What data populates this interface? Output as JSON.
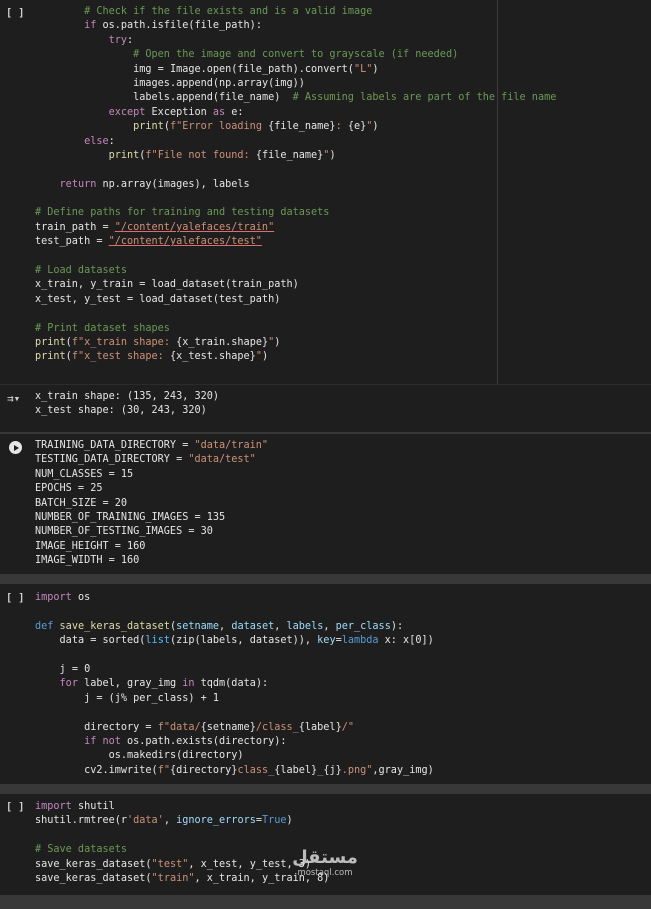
{
  "cell1": {
    "gutter": "[ ]",
    "lines": [
      {
        "indent": "        ",
        "parts": [
          [
            "cm",
            "# Check if the file exists and is a valid image"
          ]
        ]
      },
      {
        "indent": "        ",
        "parts": [
          [
            "kw2",
            "if "
          ],
          [
            "t",
            "os.path.isfile(file_path):"
          ]
        ]
      },
      {
        "indent": "            ",
        "parts": [
          [
            "kw2",
            "try"
          ],
          [
            "t",
            ":"
          ]
        ]
      },
      {
        "indent": "                ",
        "parts": [
          [
            "cm",
            "# Open the image and convert to grayscale (if needed)"
          ]
        ]
      },
      {
        "indent": "                ",
        "parts": [
          [
            "t",
            "img = Image.open(file_path).convert("
          ],
          [
            "str",
            "\"L\""
          ],
          [
            "t",
            ")"
          ]
        ]
      },
      {
        "indent": "                ",
        "parts": [
          [
            "t",
            "images.append(np.array(img))"
          ]
        ]
      },
      {
        "indent": "                ",
        "parts": [
          [
            "t",
            "labels.append(file_name)  "
          ],
          [
            "cm",
            "# Assuming labels are part of the file name"
          ]
        ]
      },
      {
        "indent": "            ",
        "parts": [
          [
            "kw2",
            "except "
          ],
          [
            "t",
            "Exception "
          ],
          [
            "kw2",
            "as "
          ],
          [
            "t",
            "e:"
          ]
        ]
      },
      {
        "indent": "                ",
        "parts": [
          [
            "fn",
            "print"
          ],
          [
            "t",
            "("
          ],
          [
            "str",
            "f\"Error loading "
          ],
          [
            "t",
            "{file_name}"
          ],
          [
            "str",
            ": "
          ],
          [
            "t",
            "{e}"
          ],
          [
            "str",
            "\""
          ],
          [
            "t",
            ")"
          ]
        ]
      },
      {
        "indent": "        ",
        "parts": [
          [
            "kw2",
            "else"
          ],
          [
            "t",
            ":"
          ]
        ]
      },
      {
        "indent": "            ",
        "parts": [
          [
            "fn",
            "print"
          ],
          [
            "t",
            "("
          ],
          [
            "str",
            "f\"File not found: "
          ],
          [
            "t",
            "{file_name}"
          ],
          [
            "str",
            "\""
          ],
          [
            "t",
            ")"
          ]
        ]
      },
      {
        "indent": "",
        "parts": []
      },
      {
        "indent": "    ",
        "parts": [
          [
            "kw2",
            "return "
          ],
          [
            "t",
            "np.array(images), labels"
          ]
        ]
      },
      {
        "indent": "",
        "parts": []
      },
      {
        "indent": "",
        "parts": [
          [
            "cm",
            "# Define paths for training and testing datasets"
          ]
        ]
      },
      {
        "indent": "",
        "parts": [
          [
            "t",
            "train_path = "
          ],
          [
            "stru",
            "\"/content/yalefaces/train\""
          ]
        ]
      },
      {
        "indent": "",
        "parts": [
          [
            "t",
            "test_path = "
          ],
          [
            "stru",
            "\"/content/yalefaces/test\""
          ]
        ]
      },
      {
        "indent": "",
        "parts": []
      },
      {
        "indent": "",
        "parts": [
          [
            "cm",
            "# Load datasets"
          ]
        ]
      },
      {
        "indent": "",
        "parts": [
          [
            "t",
            "x_train, y_train = load_dataset(train_path)"
          ]
        ]
      },
      {
        "indent": "",
        "parts": [
          [
            "t",
            "x_test, y_test = load_dataset(test_path)"
          ]
        ]
      },
      {
        "indent": "",
        "parts": []
      },
      {
        "indent": "",
        "parts": [
          [
            "cm",
            "# Print dataset shapes"
          ]
        ]
      },
      {
        "indent": "",
        "parts": [
          [
            "fn",
            "print"
          ],
          [
            "t",
            "("
          ],
          [
            "str",
            "f\"x_train shape: "
          ],
          [
            "t",
            "{x_train.shape}"
          ],
          [
            "str",
            "\""
          ],
          [
            "t",
            ")"
          ]
        ]
      },
      {
        "indent": "",
        "parts": [
          [
            "fn",
            "print"
          ],
          [
            "t",
            "("
          ],
          [
            "str",
            "f\"x_test shape: "
          ],
          [
            "t",
            "{x_test.shape}"
          ],
          [
            "str",
            "\""
          ],
          [
            "t",
            ")"
          ]
        ]
      }
    ]
  },
  "output1": {
    "lines": [
      "x_train shape: (135, 243, 320)",
      "x_test shape: (30, 243, 320)"
    ]
  },
  "cell2": {
    "lines": [
      {
        "indent": "",
        "parts": [
          [
            "t",
            "TRAINING_DATA_DIRECTORY = "
          ],
          [
            "str",
            "\"data/train\""
          ]
        ]
      },
      {
        "indent": "",
        "parts": [
          [
            "t",
            "TESTING_DATA_DIRECTORY = "
          ],
          [
            "str",
            "\"data/test\""
          ]
        ]
      },
      {
        "indent": "",
        "parts": [
          [
            "t",
            "NUM_CLASSES = 15"
          ]
        ]
      },
      {
        "indent": "",
        "parts": [
          [
            "t",
            "EPOCHS = 25"
          ]
        ]
      },
      {
        "indent": "",
        "parts": [
          [
            "t",
            "BATCH_SIZE = 20"
          ]
        ]
      },
      {
        "indent": "",
        "parts": [
          [
            "t",
            "NUMBER_OF_TRAINING_IMAGES = 135"
          ]
        ]
      },
      {
        "indent": "",
        "parts": [
          [
            "t",
            "NUMBER_OF_TESTING_IMAGES = 30"
          ]
        ]
      },
      {
        "indent": "",
        "parts": [
          [
            "t",
            "IMAGE_HEIGHT = 160"
          ]
        ]
      },
      {
        "indent": "",
        "parts": [
          [
            "t",
            "IMAGE_WIDTH = 160"
          ]
        ]
      }
    ]
  },
  "cell3": {
    "gutter": "[ ]",
    "lines": [
      {
        "indent": "",
        "parts": [
          [
            "kw2",
            "import "
          ],
          [
            "t",
            "os"
          ]
        ]
      },
      {
        "indent": "",
        "parts": []
      },
      {
        "indent": "",
        "parts": [
          [
            "kw",
            "def "
          ],
          [
            "fn",
            "save_keras_dataset"
          ],
          [
            "t",
            "("
          ],
          [
            "var",
            "setname"
          ],
          [
            "t",
            ", "
          ],
          [
            "var",
            "dataset"
          ],
          [
            "t",
            ", "
          ],
          [
            "var",
            "labels"
          ],
          [
            "t",
            ", "
          ],
          [
            "var",
            "per_class"
          ],
          [
            "t",
            "):"
          ]
        ]
      },
      {
        "indent": "    ",
        "parts": [
          [
            "t",
            "data = sorted("
          ],
          [
            "bl",
            "list"
          ],
          [
            "t",
            "(zip(labels, dataset)), "
          ],
          [
            "var",
            "key"
          ],
          [
            "t",
            "="
          ],
          [
            "kw",
            "lambda "
          ],
          [
            "t",
            "x: x[0])"
          ]
        ]
      },
      {
        "indent": "",
        "parts": []
      },
      {
        "indent": "    ",
        "parts": [
          [
            "t",
            "j = 0"
          ]
        ]
      },
      {
        "indent": "    ",
        "parts": [
          [
            "kw2",
            "for "
          ],
          [
            "t",
            "label, gray_img "
          ],
          [
            "kw2",
            "in "
          ],
          [
            "t",
            "tqdm(data):"
          ]
        ]
      },
      {
        "indent": "        ",
        "parts": [
          [
            "t",
            "j = (j% per_class) + 1"
          ]
        ]
      },
      {
        "indent": "",
        "parts": []
      },
      {
        "indent": "        ",
        "parts": [
          [
            "t",
            "directory = "
          ],
          [
            "str",
            "f\"data/"
          ],
          [
            "t",
            "{setname}"
          ],
          [
            "str",
            "/class_"
          ],
          [
            "t",
            "{label}"
          ],
          [
            "str",
            "/\""
          ]
        ]
      },
      {
        "indent": "        ",
        "parts": [
          [
            "kw2",
            "if not "
          ],
          [
            "t",
            "os.path.exists(directory):"
          ]
        ]
      },
      {
        "indent": "            ",
        "parts": [
          [
            "t",
            "os.makedirs(directory)"
          ]
        ]
      },
      {
        "indent": "        ",
        "parts": [
          [
            "t",
            "cv2.imwrite("
          ],
          [
            "str",
            "f\""
          ],
          [
            "t",
            "{directory}"
          ],
          [
            "str",
            "class_"
          ],
          [
            "t",
            "{label}"
          ],
          [
            "str",
            "_"
          ],
          [
            "t",
            "{j}"
          ],
          [
            "str",
            ".png\""
          ],
          [
            "t",
            ",gray_img)"
          ]
        ]
      }
    ]
  },
  "cell4": {
    "gutter": "[ ]",
    "lines": [
      {
        "indent": "",
        "parts": [
          [
            "kw2",
            "import "
          ],
          [
            "t",
            "shutil"
          ]
        ]
      },
      {
        "indent": "",
        "parts": [
          [
            "t",
            "shutil.rmtree(r"
          ],
          [
            "str",
            "'data'"
          ],
          [
            "t",
            ", "
          ],
          [
            "var",
            "ignore_errors"
          ],
          [
            "t",
            "="
          ],
          [
            "kw",
            "True"
          ],
          [
            "t",
            ")"
          ]
        ]
      },
      {
        "indent": "",
        "parts": []
      },
      {
        "indent": "",
        "parts": [
          [
            "cm",
            "# Save datasets"
          ]
        ]
      },
      {
        "indent": "",
        "parts": [
          [
            "t",
            "save_keras_dataset("
          ],
          [
            "str",
            "\"test\""
          ],
          [
            "t",
            ", x_test, y_test, 3)"
          ]
        ]
      },
      {
        "indent": "",
        "parts": [
          [
            "t",
            "save_keras_dataset("
          ],
          [
            "str",
            "\"train\""
          ],
          [
            "t",
            ", x_train, y_train, 8)"
          ]
        ]
      }
    ]
  },
  "watermark": {
    "arabic": "مستقل",
    "latin": "mostaql.com"
  }
}
